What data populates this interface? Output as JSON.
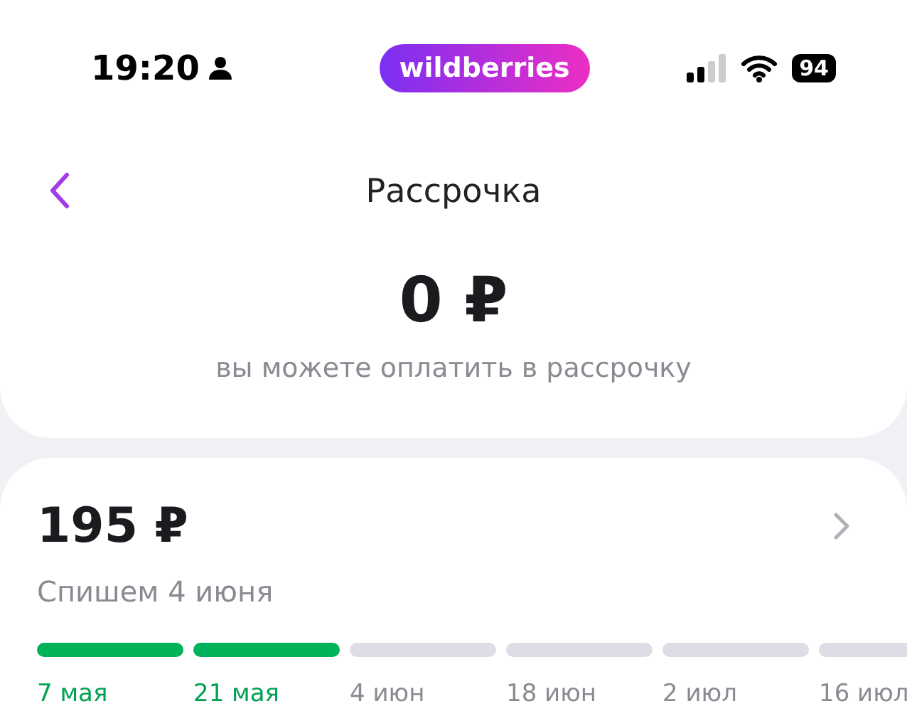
{
  "status_bar": {
    "time": "19:20",
    "logo": "wildberries",
    "battery": "94"
  },
  "header": {
    "title": "Рассрочка"
  },
  "available": {
    "amount": "0 ₽",
    "caption": "вы можете оплатить в рассрочку"
  },
  "payment": {
    "amount": "195 ₽",
    "caption": "Спишем 4 июня",
    "steps": [
      {
        "date": "7 мая",
        "paid": true
      },
      {
        "date": "21 мая",
        "paid": true
      },
      {
        "date": "4 июн",
        "paid": false
      },
      {
        "date": "18 июн",
        "paid": false
      },
      {
        "date": "2 июл",
        "paid": false
      },
      {
        "date": "16 июл",
        "paid": false
      }
    ]
  }
}
